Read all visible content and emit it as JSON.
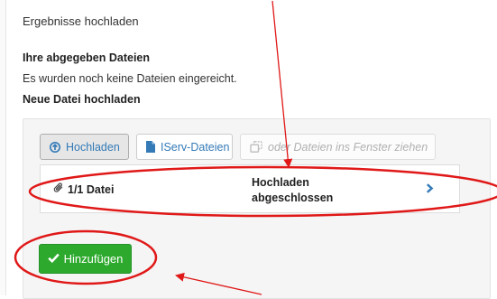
{
  "section": {
    "title": "Ergebnisse hochladen"
  },
  "submitted": {
    "heading": "Ihre abgegeben Dateien",
    "empty_text": "Es wurden noch keine Dateien eingereicht."
  },
  "new_file": {
    "heading": "Neue Datei hochladen"
  },
  "toolbar": {
    "upload_label": "Hochladen",
    "iserv_label": "IServ-Dateien",
    "drop_label": "oder Dateien ins Fenster ziehen"
  },
  "file_row": {
    "count": "1/1 Datei",
    "status_line1": "Hochladen",
    "status_line2": "abgeschlossen"
  },
  "add_button": {
    "label": "Hinzufügen"
  },
  "colors": {
    "link": "#337ab7",
    "success": "#2daa2d",
    "annotation": "#e01818"
  },
  "icons": [
    "arrow-circle-up-icon",
    "file-icon",
    "copy-icon",
    "paperclip-icon",
    "chevron-right-icon",
    "check-icon"
  ]
}
